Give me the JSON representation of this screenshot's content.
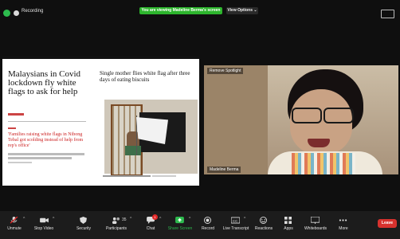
{
  "topbar": {
    "recording_label": "Recording",
    "banner": "You are viewing Madeline Berma's screen",
    "view_options": "View Options ⌄"
  },
  "slide": {
    "headline": "Malaysians in Covid lockdown fly white flags to ask for help",
    "right_headline": "Single mother flies white flag after three days of eating biscuits",
    "subhead": "'Families raising white flags in Nibong Tebal got scolding instead of help from rep's office'"
  },
  "video": {
    "spotlight_label": "Remove Spotlight",
    "participant_name": "Madeline Berma"
  },
  "toolbar": {
    "unmute": "Unmute",
    "stop_video": "Stop Video",
    "security": "Security",
    "participants": "Participants",
    "participants_count": "35",
    "chat": "Chat",
    "chat_badge": "1",
    "share_screen": "Share Screen",
    "record": "Record",
    "live_transcript": "Live Transcript",
    "reactions": "Reactions",
    "apps": "Apps",
    "whiteboards": "Whiteboards",
    "more": "More",
    "leave": "Leave"
  },
  "colors": {
    "banner_green": "#2db52d",
    "share_green": "#2dbb4e",
    "leave_red": "#d7322e"
  }
}
